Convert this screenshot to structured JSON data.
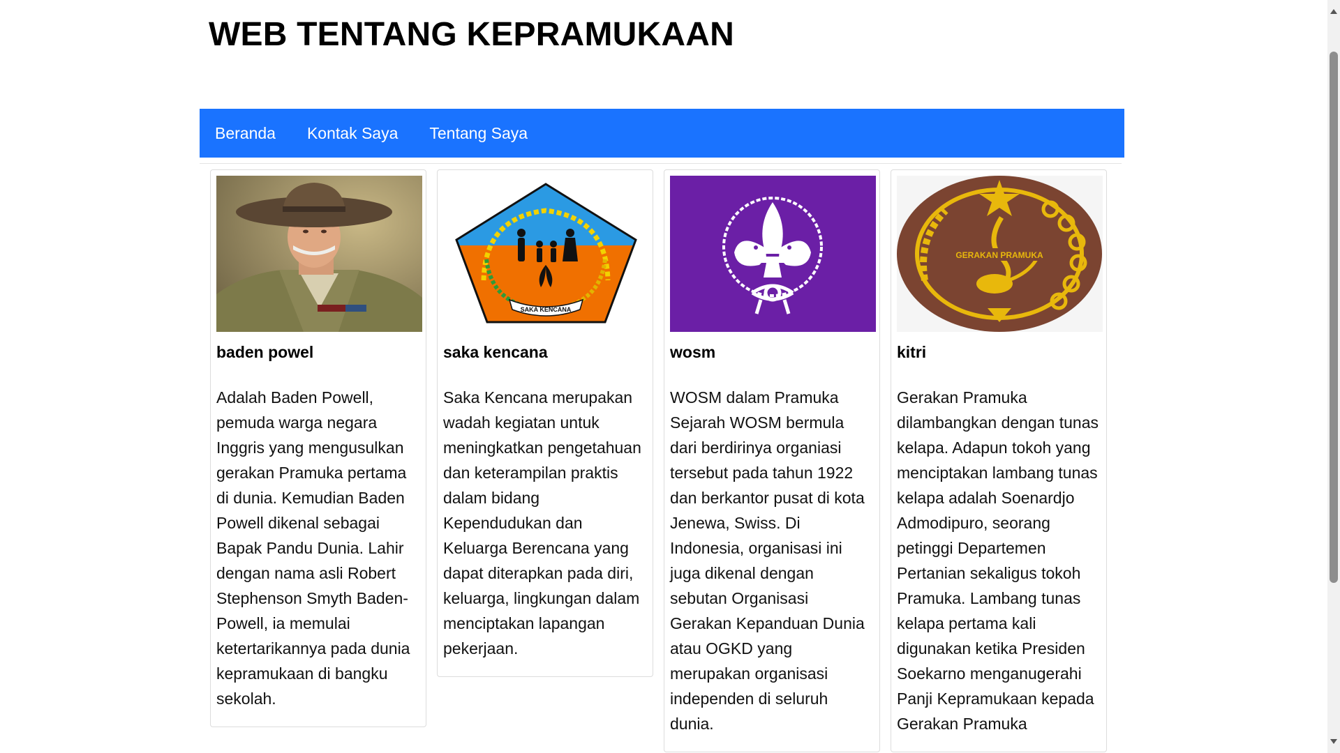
{
  "header": {
    "title": "WEB TENTANG KEPRAMUKAAN"
  },
  "nav": {
    "items": [
      {
        "label": "Beranda"
      },
      {
        "label": "Kontak Saya"
      },
      {
        "label": "Tentang Saya"
      }
    ],
    "background": "#1a73ff"
  },
  "cards": [
    {
      "title": "baden powel",
      "image": "baden-powell-portrait",
      "text": "Adalah Baden Powell, pemuda warga negara Inggris yang mengusulkan gerakan Pramuka pertama di dunia. Kemudian Baden Powell dikenal sebagai Bapak Pandu Dunia. Lahir dengan nama asli Robert Stephenson Smyth Baden-Powell, ia memulai ketertarikannya pada dunia kepramukaan di bangku sekolah."
    },
    {
      "title": "saka kencana",
      "image": "saka-kencana-logo",
      "logo_text": "SAKA KENCANA",
      "text": "Saka Kencana merupakan wadah kegiatan untuk meningkatkan pengetahuan dan keterampilan praktis dalam bidang Kependudukan dan Keluarga Berencana yang dapat diterapkan pada diri, keluarga, lingkungan dalam menciptakan lapangan pekerjaan."
    },
    {
      "title": "wosm",
      "image": "wosm-fleur-de-lis-logo",
      "text": "WOSM dalam Pramuka Sejarah WOSM bermula dari berdirinya organiasi tersebut pada tahun 1922 dan berkantor pusat di kota Jenewa, Swiss. Di Indonesia, organisasi ini juga dikenal dengan sebutan Organisasi Gerakan Kepanduan Dunia atau OGKD yang merupakan organisasi independen di seluruh dunia."
    },
    {
      "title": "kitri",
      "image": "gerakan-pramuka-badge",
      "logo_text": "GERAKAN PRAMUKA",
      "text": "Gerakan Pramuka dilambangkan dengan tunas kelapa. Adapun tokoh yang menciptakan lambang tunas kelapa adalah Soenardjo Admodipuro, seorang petinggi Departemen Pertanian sekaligus tokoh Pramuka. Lambang tunas kelapa pertama kali digunakan ketika Presiden Soekarno menganugerahi Panji Kepramukaan kepada Gerakan Pramuka"
    }
  ]
}
